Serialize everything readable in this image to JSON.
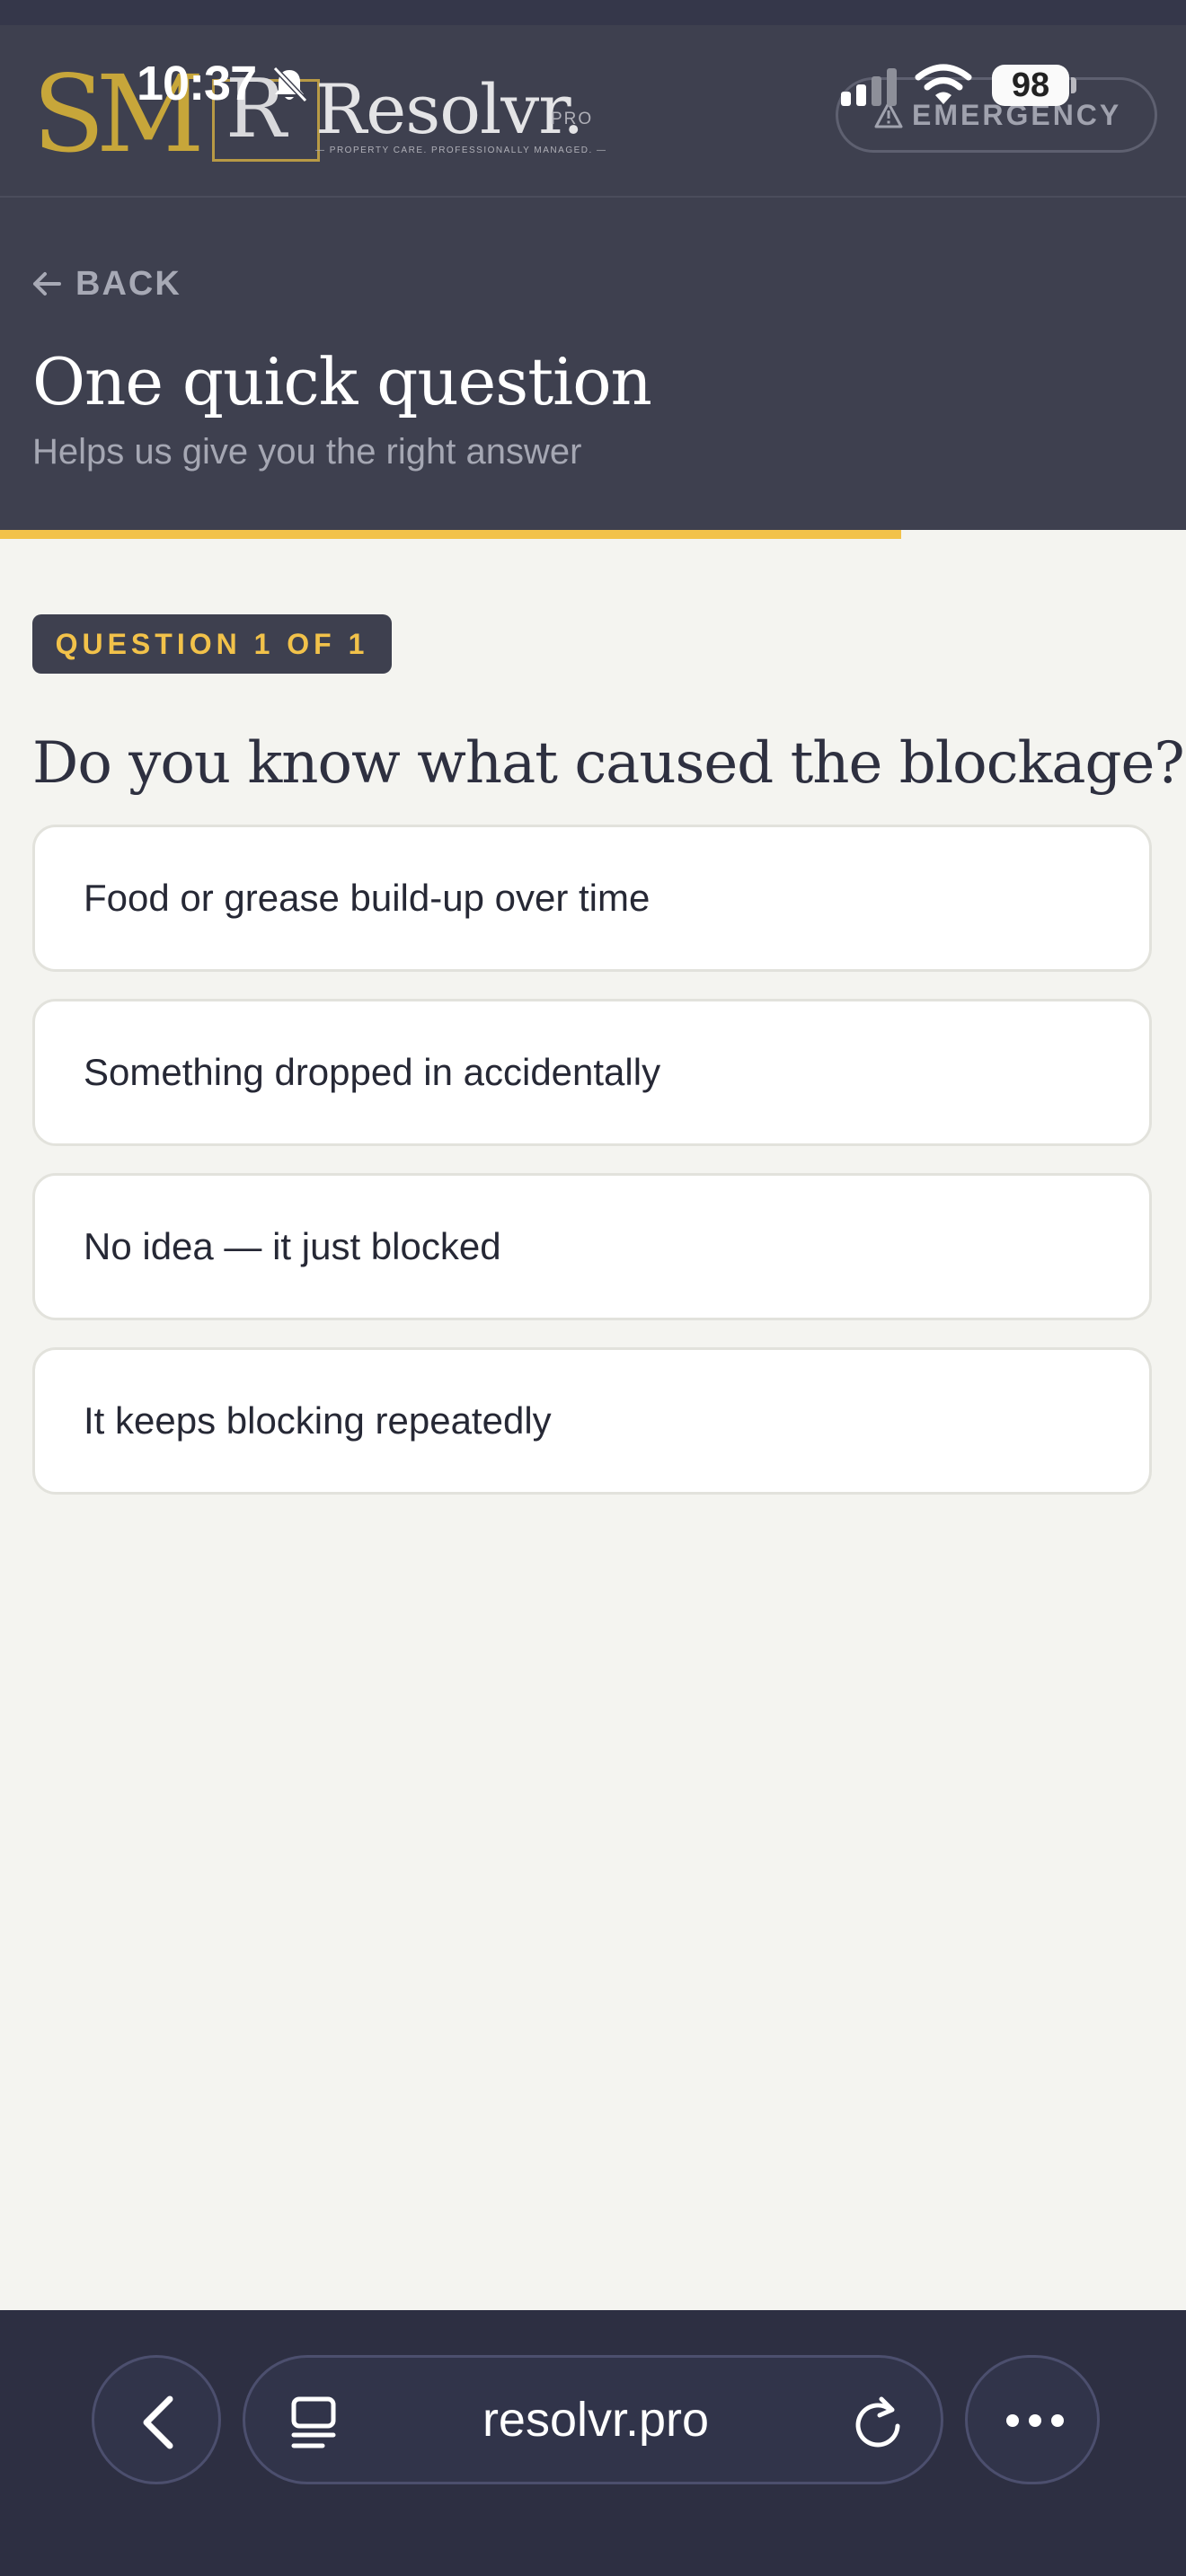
{
  "status_bar": {
    "time": "10:37",
    "battery": "98"
  },
  "brand": {
    "monogram": "SM",
    "r_mark": "R",
    "name": "Resolvr.",
    "suffix": "PRO",
    "tagline": "— PROPERTY CARE. PROFESSIONALLY MANAGED. —"
  },
  "header": {
    "emergency_label": "EMERGENCY",
    "back_label": "BACK",
    "title": "One quick question",
    "subtitle": "Helps us give you the right answer",
    "progress_fraction": 0.76,
    "colors": {
      "background": "#3e404f",
      "accent": "#f2c24a"
    }
  },
  "question": {
    "badge": "QUESTION 1 OF 1",
    "text": "Do you know what caused the blockage?",
    "options": [
      "Food or grease build-up over time",
      "Something dropped in accidentally",
      "No idea — it just blocked",
      "It keeps blocking repeatedly"
    ]
  },
  "browser": {
    "url": "resolvr.pro"
  },
  "icons": [
    "bell-slash-icon",
    "signal-icon",
    "wifi-icon",
    "warning-icon",
    "arrow-left-icon",
    "chevron-left-icon",
    "tabs-icon",
    "reload-icon",
    "more-icon"
  ]
}
